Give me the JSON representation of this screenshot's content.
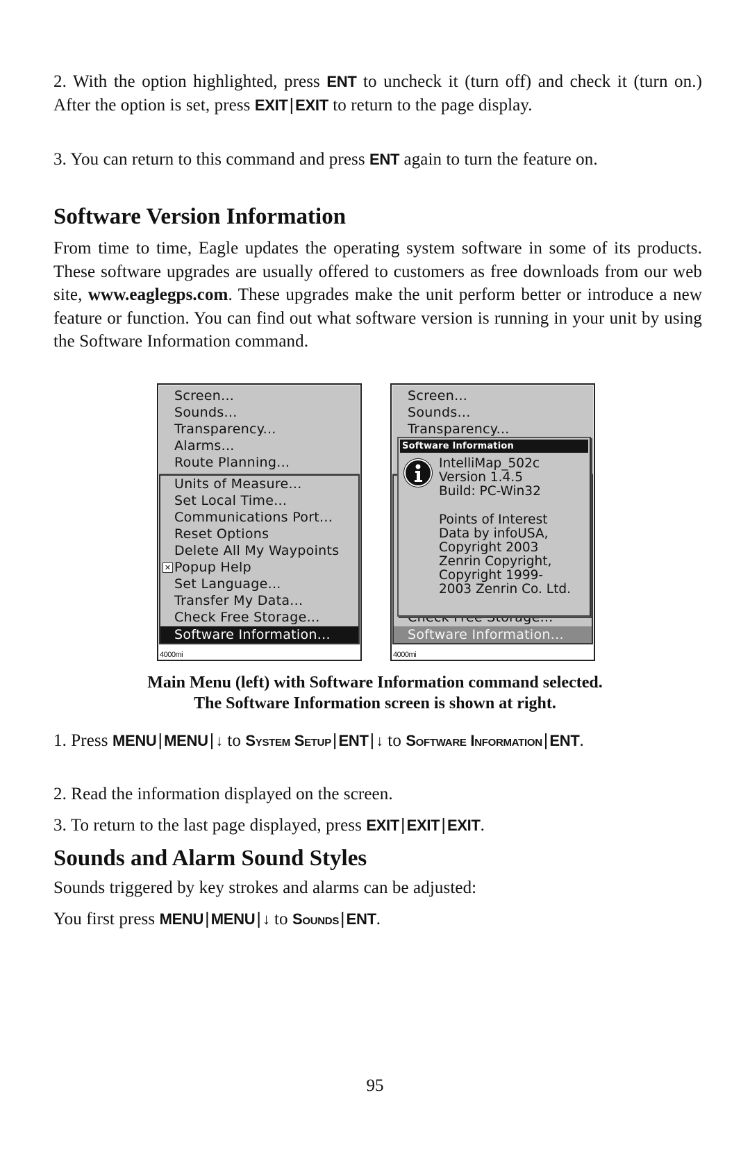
{
  "intro_steps": {
    "step2": {
      "a": "2. With the option highlighted, press ",
      "k1": "ENT",
      "b": " to uncheck it (turn off) and check it (turn on.) After the option is set, press ",
      "k2": "EXIT",
      "k3": "EXIT",
      "c": " to return to the page display."
    },
    "step3": {
      "a": "3. You can return to this command and press ",
      "k1": "ENT",
      "b": " again to turn the feature on."
    }
  },
  "section1": {
    "heading": "Software Version Information",
    "body_a": "From time to time, Eagle updates the operating system software in some of its products. These software upgrades are usually offered to customers as free downloads from our web site, ",
    "url": "www.eaglegps.com",
    "body_b": ". These upgrades make the unit perform better or introduce a new feature or function. You can find out what software version is running in your unit by using the Software Information command."
  },
  "left_screen": {
    "top_items": [
      "Screen...",
      "Sounds...",
      "Transparency...",
      "Alarms...",
      "Route Planning..."
    ],
    "bottom_items": [
      "Units of Measure...",
      "Set Local Time...",
      "Communications Port...",
      "Reset Options",
      "Delete All My Waypoints",
      "Popup Help",
      "Set Language...",
      "Transfer My Data...",
      "Check Free Storage..."
    ],
    "selected_item": "Software Information...",
    "checkbox_mark": "✕",
    "scale": "4000mi"
  },
  "right_screen": {
    "top_items": [
      "Screen...",
      "Sounds...",
      "Transparency..."
    ],
    "partial_item": "Check Free Storage...",
    "selected_item": "Software Information...",
    "scale": "4000mi",
    "popup": {
      "title": "Software Information",
      "lines": [
        "IntelliMap_502c",
        "Version 1.4.5",
        "Build: PC-Win32",
        "",
        "Points of Interest",
        "Data by infoUSA,",
        "Copyright 2003",
        "Zenrin Copyright,",
        "Copyright 1999-",
        "2003 Zenrin Co. Ltd."
      ]
    }
  },
  "caption": {
    "line1": "Main Menu (left) with Software Information command selected.",
    "line2": "The Software Information screen is shown at right."
  },
  "steps": {
    "s1": {
      "num": "1. Press ",
      "k1": "MENU",
      "k2": "MENU",
      "arrow": "↓",
      "to1": " to ",
      "sc1": "System Setup",
      "k3": "ENT",
      "to2": " to ",
      "sc2": "Software Information",
      "k4": "ENT"
    },
    "s2": "2. Read the information displayed on the screen.",
    "s3": {
      "a": "3. To return to the last page displayed, press ",
      "k1": "EXIT",
      "k2": "EXIT",
      "k3": "EXIT"
    }
  },
  "section2": {
    "heading": "Sounds and Alarm Sound Styles",
    "body": "Sounds triggered by key strokes and alarms can be adjusted:",
    "instr": {
      "a": "You first press ",
      "k1": "MENU",
      "k2": "MENU",
      "arrow": "↓",
      "to": " to ",
      "sc": "Sounds",
      "k3": "ENT"
    }
  },
  "page_number": "95"
}
